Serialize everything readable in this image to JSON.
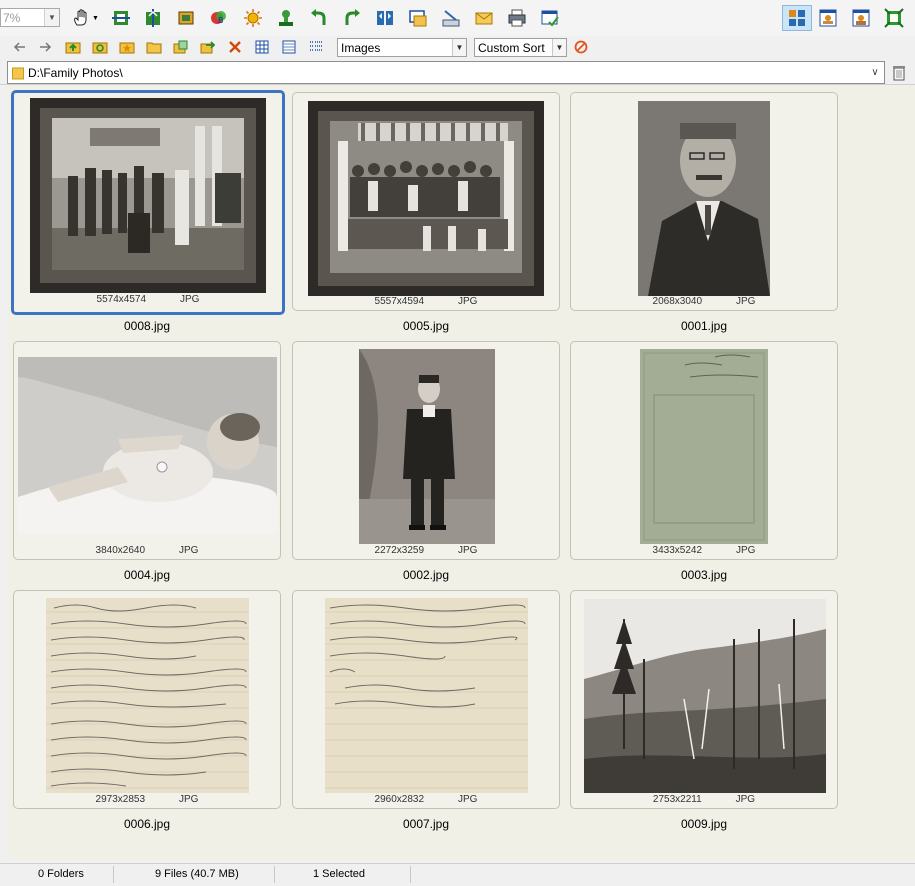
{
  "toolbar": {
    "zoom_value": "7%",
    "view_modes": [
      "thumbnails-view-icon",
      "filmstrip-view-icon",
      "preview-view-icon",
      "fullscreen-icon"
    ]
  },
  "nav": {
    "filter_value": "Images",
    "sort_value": "Custom Sort"
  },
  "address": {
    "path": "D:\\Family Photos\\"
  },
  "files": [
    {
      "name": "0008.jpg",
      "dims": "5574x4574",
      "type": "JPG"
    },
    {
      "name": "0005.jpg",
      "dims": "5557x4594",
      "type": "JPG"
    },
    {
      "name": "0001.jpg",
      "dims": "2068x3040",
      "type": "JPG"
    },
    {
      "name": "0004.jpg",
      "dims": "3840x2640",
      "type": "JPG"
    },
    {
      "name": "0002.jpg",
      "dims": "2272x3259",
      "type": "JPG"
    },
    {
      "name": "0003.jpg",
      "dims": "3433x5242",
      "type": "JPG"
    },
    {
      "name": "0006.jpg",
      "dims": "2973x2853",
      "type": "JPG"
    },
    {
      "name": "0007.jpg",
      "dims": "2960x2832",
      "type": "JPG"
    },
    {
      "name": "0009.jpg",
      "dims": "2753x2211",
      "type": "JPG"
    }
  ],
  "status": {
    "folders": "0 Folders",
    "files": "9 Files (40.7 MB)",
    "selected": "1 Selected"
  },
  "colors": {
    "selection": "#3c73c3",
    "content_bg": "#f1f0e7"
  }
}
